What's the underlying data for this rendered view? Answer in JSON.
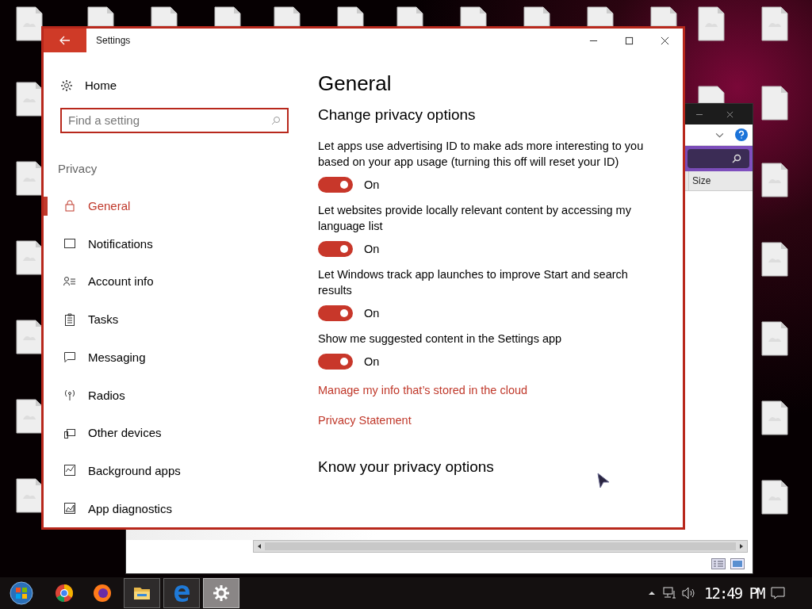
{
  "settings_window": {
    "title": "Settings",
    "home": "Home",
    "search": {
      "placeholder": "Find a setting"
    },
    "section": "Privacy",
    "nav": [
      {
        "label": "General",
        "selected": true
      },
      {
        "label": "Notifications",
        "selected": false
      },
      {
        "label": "Account info",
        "selected": false
      },
      {
        "label": "Tasks",
        "selected": false
      },
      {
        "label": "Messaging",
        "selected": false
      },
      {
        "label": "Radios",
        "selected": false
      },
      {
        "label": "Other devices",
        "selected": false
      },
      {
        "label": "Background apps",
        "selected": false
      },
      {
        "label": "App diagnostics",
        "selected": false
      }
    ],
    "heading": "General",
    "subheading": "Change privacy options",
    "options": [
      {
        "text": "Let apps use advertising ID to make ads more interesting to you based on your app usage (turning this off will reset your ID)",
        "on": true,
        "state_label": "On"
      },
      {
        "text": "Let websites provide locally relevant content by accessing my language list",
        "on": true,
        "state_label": "On"
      },
      {
        "text": "Let Windows track app launches to improve Start and search results",
        "on": true,
        "state_label": "On"
      },
      {
        "text": "Show me suggested content in the Settings app",
        "on": true,
        "state_label": "On"
      }
    ],
    "links": [
      "Manage my info that’s stored in the cloud",
      "Privacy Statement"
    ],
    "heading2": "Know your privacy options"
  },
  "explorer_window": {
    "column_header": "Size"
  },
  "taskbar": {
    "apps": [
      {
        "selected": false,
        "open": false
      },
      {
        "selected": false,
        "open": false
      },
      {
        "selected": false,
        "open": true
      },
      {
        "selected": false,
        "open": true
      },
      {
        "selected": true,
        "open": true
      }
    ],
    "clock": "12:49 PM"
  }
}
